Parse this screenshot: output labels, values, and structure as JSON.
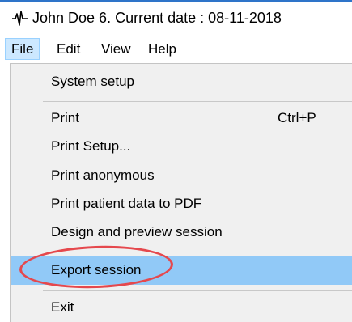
{
  "window": {
    "title": "John Doe 6. Current date : 08-11-2018",
    "icon": "ecg-waveform-icon"
  },
  "menubar": {
    "items": [
      {
        "label": "File",
        "active": true
      },
      {
        "label": "Edit"
      },
      {
        "label": "View"
      },
      {
        "label": "Help"
      }
    ]
  },
  "file_menu": {
    "items": [
      {
        "label": "System setup"
      },
      {
        "label": "Print",
        "shortcut": "Ctrl+P"
      },
      {
        "label": "Print Setup..."
      },
      {
        "label": "Print anonymous"
      },
      {
        "label": "Print patient data to PDF"
      },
      {
        "label": "Design and preview session"
      },
      {
        "label": "Export session",
        "highlighted": true
      },
      {
        "label": "Exit"
      }
    ]
  },
  "colors": {
    "highlight": "#91c9f7",
    "active_menu_bg": "#cce8ff",
    "annotation": "#e5484d",
    "menu_bg": "#f0f0f0"
  }
}
